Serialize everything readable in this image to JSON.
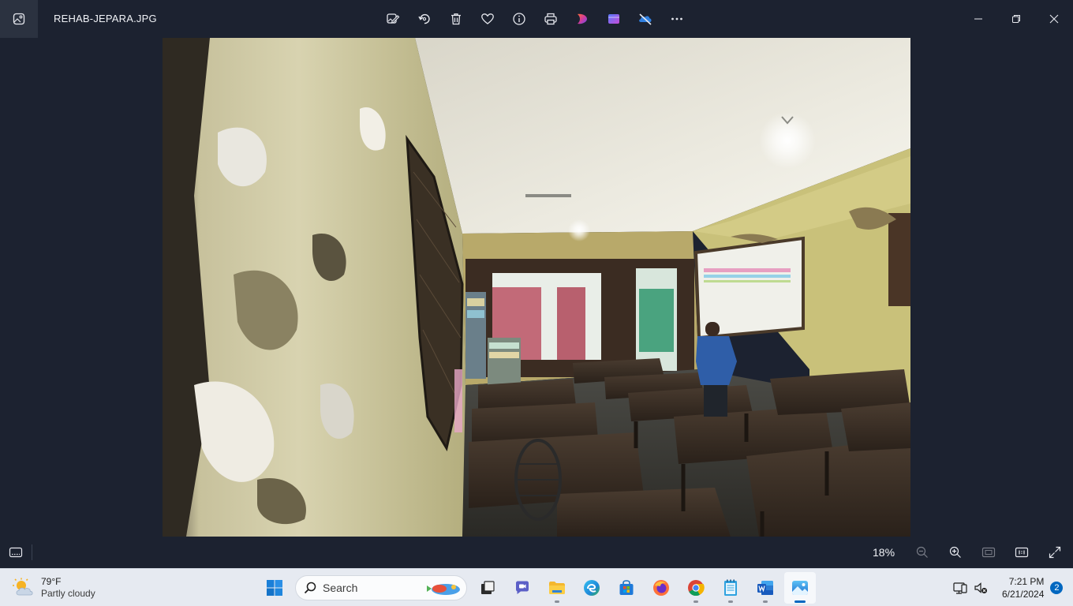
{
  "titlebar": {
    "file_name": "REHAB-JEPARA.JPG",
    "toolbar_icons": [
      "edit-image-icon",
      "rotate-icon",
      "delete-icon",
      "favorite-icon",
      "info-icon",
      "print-icon",
      "clipchamp-icon",
      "designer-icon",
      "onedrive-icon",
      "more-icon"
    ]
  },
  "statusbar": {
    "zoom": "18%"
  },
  "taskbar": {
    "weather": {
      "temp": "79°F",
      "desc": "Partly cloudy"
    },
    "search": {
      "placeholder": "Search"
    },
    "clock": {
      "time": "7:21 PM",
      "date": "6/21/2024"
    },
    "notification_count": "2"
  },
  "colors": {
    "accent": "#0067c0",
    "window_bg": "#1c2230",
    "taskbar_bg": "#e6eaf1"
  }
}
